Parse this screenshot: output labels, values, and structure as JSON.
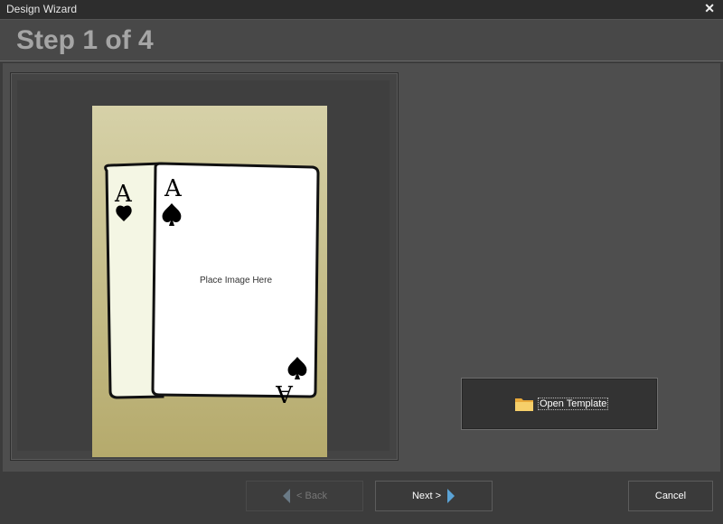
{
  "window": {
    "title": "Design Wizard",
    "close_glyph": "✕"
  },
  "header": {
    "step": "Step 1 of 4"
  },
  "preview": {
    "placeholder": "Place Image Here",
    "card_rank": "A",
    "suits": [
      "heart",
      "spade"
    ]
  },
  "actions": {
    "open_template": "Open Template",
    "folder_icon": "folder-icon"
  },
  "footer": {
    "back": "< Back",
    "next": "Next >",
    "cancel": "Cancel"
  },
  "colors": {
    "accent_arrow": "#5ba3d6",
    "disabled_arrow": "#6a7a86"
  }
}
